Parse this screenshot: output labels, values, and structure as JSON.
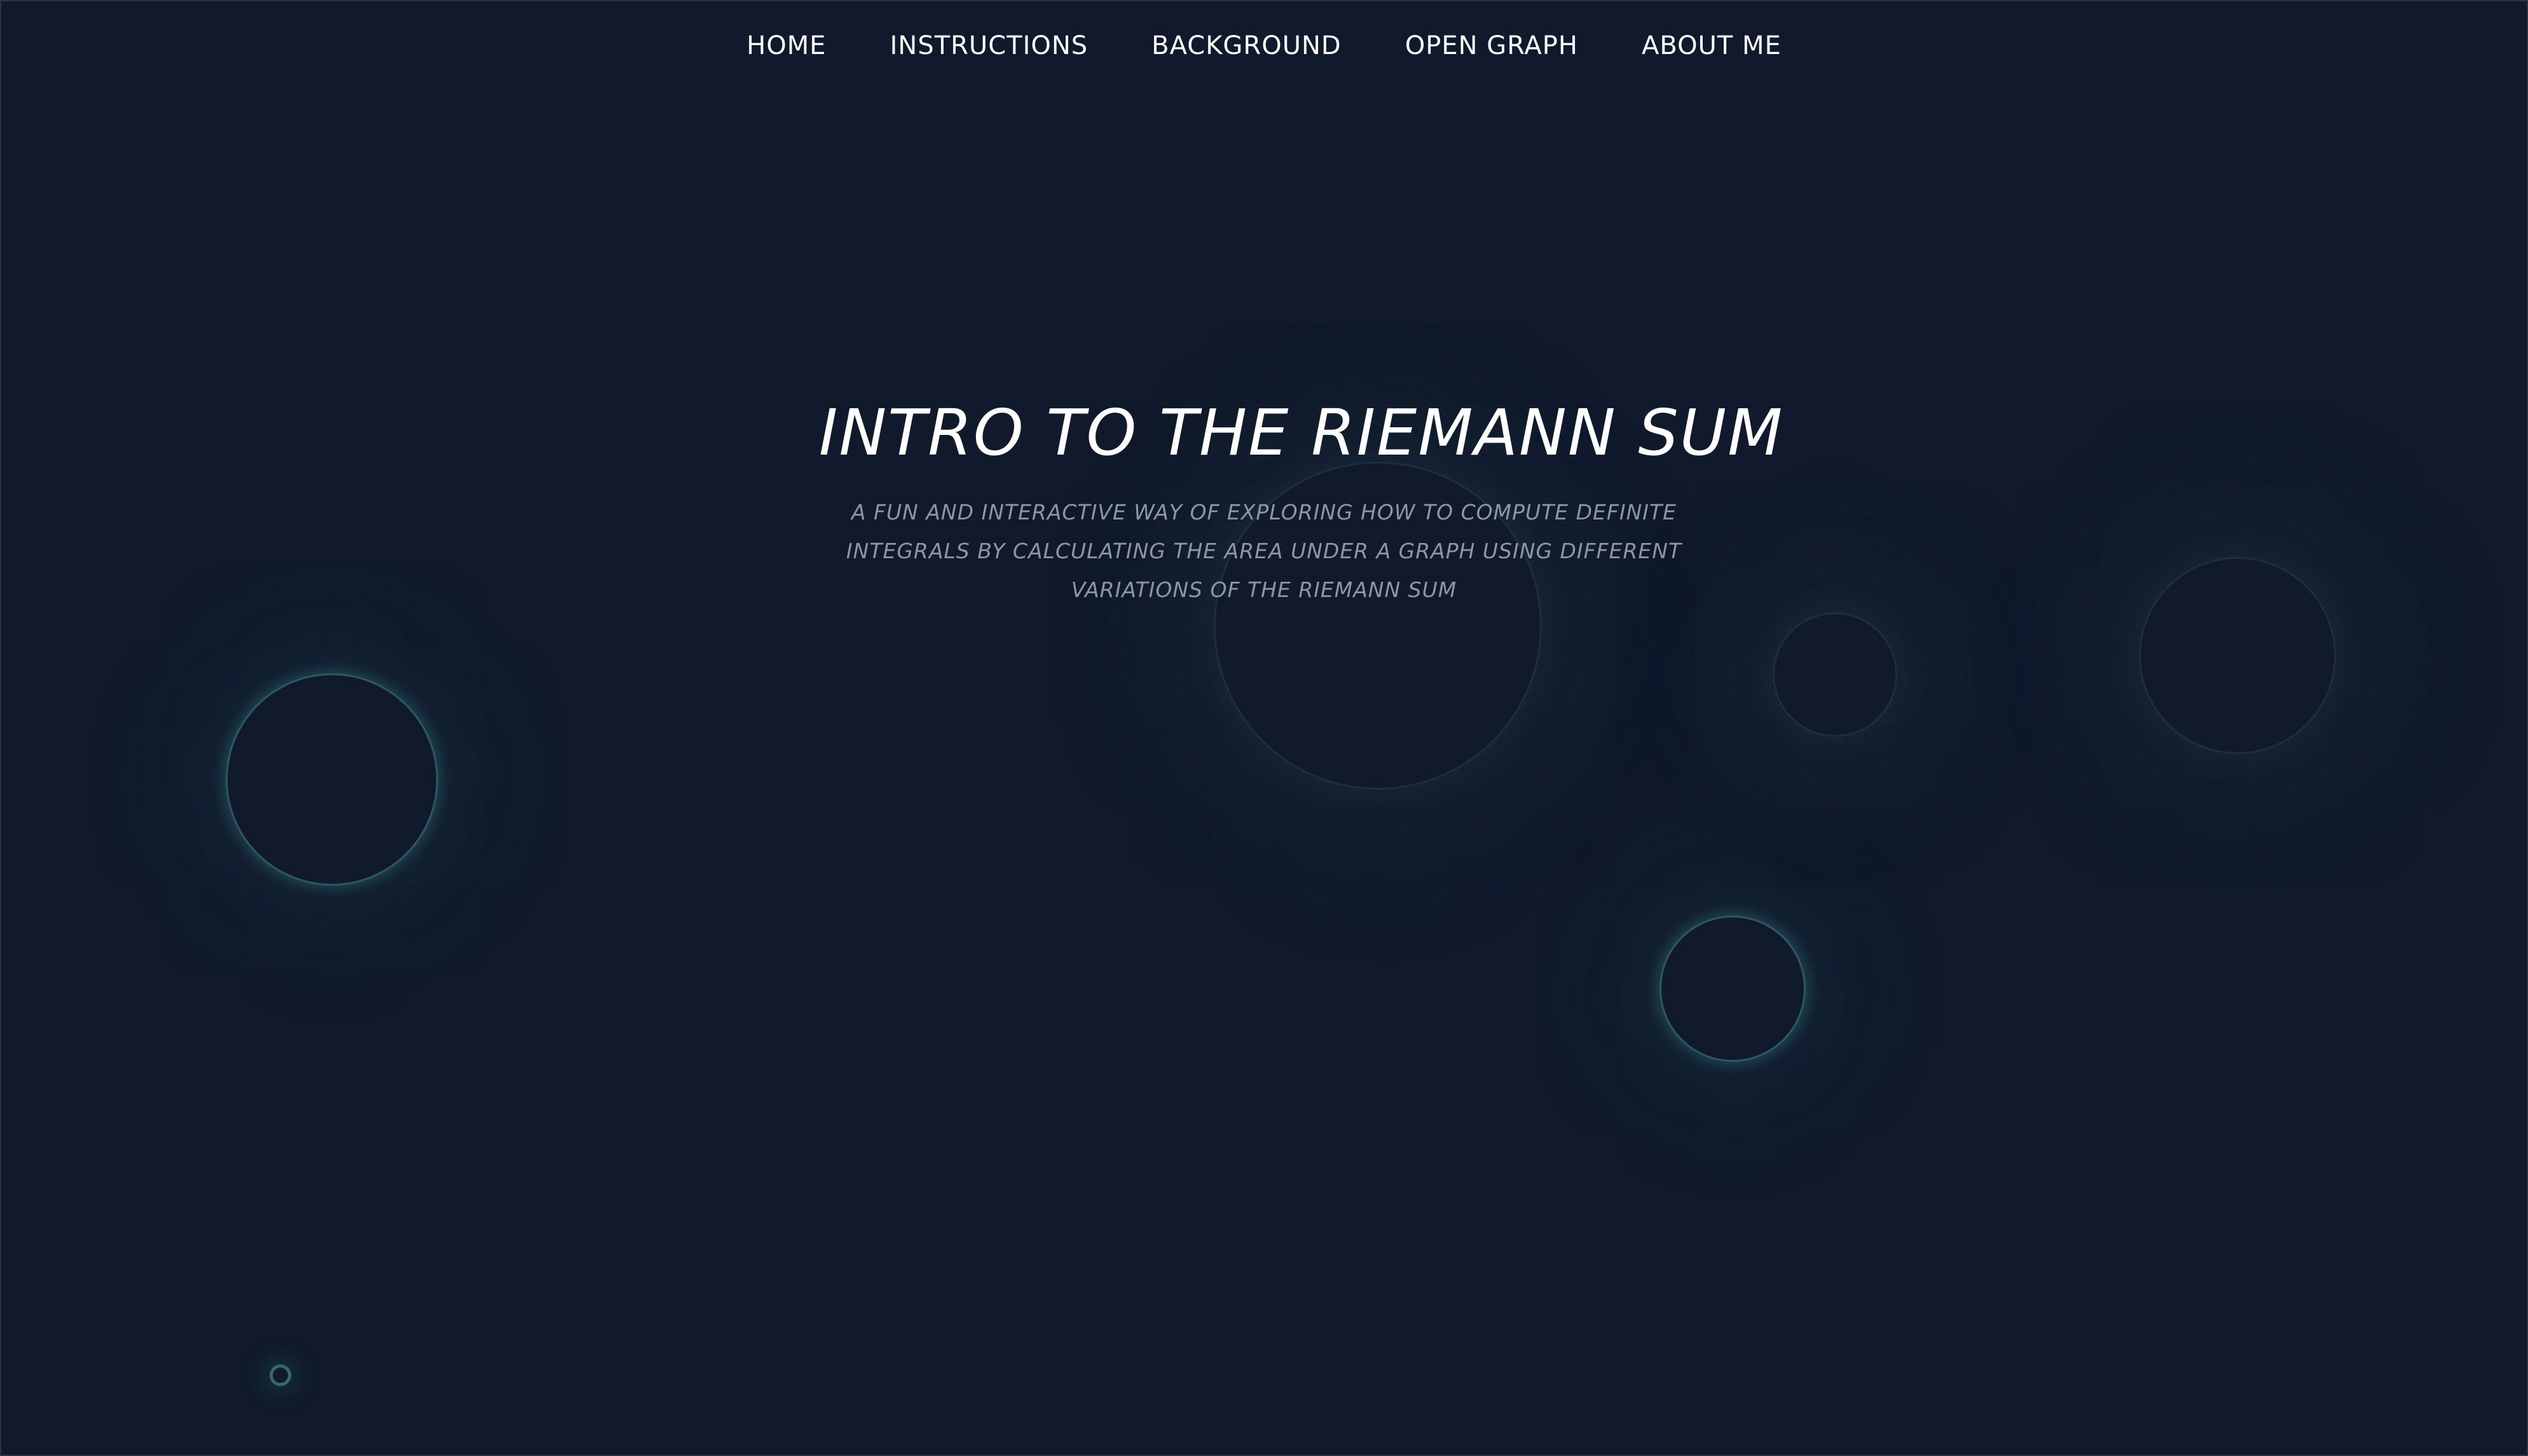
{
  "nav": {
    "items": [
      {
        "label": "HOME"
      },
      {
        "label": "INSTRUCTIONS"
      },
      {
        "label": "BACKGROUND"
      },
      {
        "label": "OPEN GRAPH"
      },
      {
        "label": "ABOUT ME"
      }
    ]
  },
  "hero": {
    "title": "INTRO TO THE RIEMANN SUM",
    "subtitle": "A FUN AND INTERACTIVE WAY OF EXPLORING HOW TO COMPUTE DEFINITE INTEGRALS BY CALCULATING THE AREA UNDER A GRAPH USING DIFFERENT VARIATIONS OF THE RIEMANN SUM"
  },
  "colors": {
    "background": "#101a2c",
    "text_primary": "#ffffff",
    "text_secondary": "#8e96a3",
    "glow": "#468c8c"
  }
}
